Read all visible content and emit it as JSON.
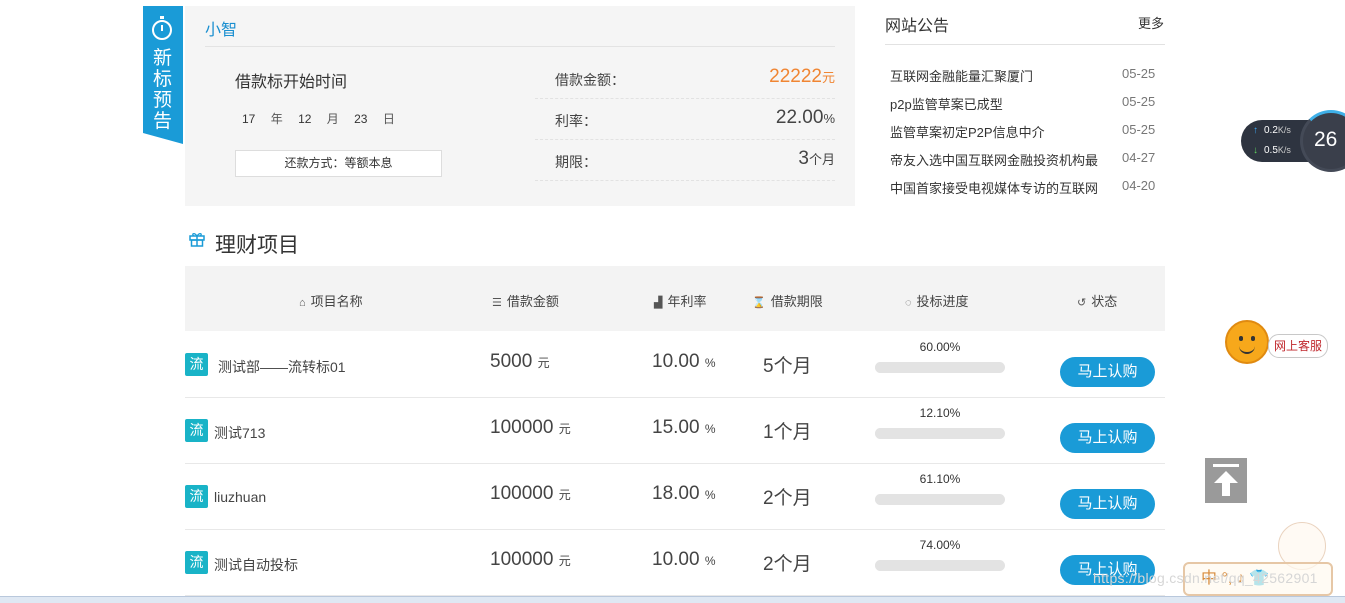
{
  "preview": {
    "ribbon_text": "新标预告",
    "name": "小智",
    "start_label": "借款标开始时间",
    "date": {
      "year": "17",
      "year_unit": "年",
      "month": "12",
      "month_unit": "月",
      "day": "23",
      "day_unit": "日"
    },
    "repay": "还款方式：等额本息",
    "amount_label": "借款金额：",
    "amount_value": "22222",
    "amount_unit": "元",
    "rate_label": "利率：",
    "rate_value": "22.00",
    "rate_unit": "%",
    "term_label": "期限：",
    "term_value": "3",
    "term_unit": "个月"
  },
  "notices": {
    "title": "网站公告",
    "more": "更多",
    "items": [
      {
        "title": "互联网金融能量汇聚厦门",
        "date": "05-25"
      },
      {
        "title": "p2p监管草案已成型",
        "date": "05-25"
      },
      {
        "title": "监管草案初定P2P信息中介",
        "date": "05-25"
      },
      {
        "title": "帝友入选中国互联网金融投资机构最",
        "date": "04-27"
      },
      {
        "title": "中国首家接受电视媒体专访的互联网",
        "date": "04-20"
      }
    ]
  },
  "section": {
    "title": "理财项目"
  },
  "table": {
    "headers": {
      "name": "项目名称",
      "amount": "借款金额",
      "rate": "年利率",
      "term": "借款期限",
      "progress": "投标进度",
      "status": "状态"
    },
    "header_icons": {
      "name": "home-icon",
      "amount": "database-icon",
      "rate": "bar-chart-icon",
      "term": "hourglass-icon",
      "progress": "spinner-icon",
      "status": "history-icon"
    },
    "rows": [
      {
        "badge": "流",
        "name": "测试部——流转标01",
        "amount": "5000",
        "amount_unit": "元",
        "rate": "10.00",
        "rate_unit": "%",
        "term": "5个月",
        "progress_text": "60.00%",
        "progress": 0.6,
        "button": "马上认购"
      },
      {
        "badge": "流",
        "name": "测试713",
        "amount": "100000",
        "amount_unit": "元",
        "rate": "15.00",
        "rate_unit": "%",
        "term": "1个月",
        "progress_text": "12.10%",
        "progress": 0.121,
        "button": "马上认购"
      },
      {
        "badge": "流",
        "name": "liuzhuan",
        "amount": "100000",
        "amount_unit": "元",
        "rate": "18.00",
        "rate_unit": "%",
        "term": "2个月",
        "progress_text": "61.10%",
        "progress": 0.611,
        "button": "马上认购"
      },
      {
        "badge": "流",
        "name": "测试自动投标",
        "amount": "100000",
        "amount_unit": "元",
        "rate": "10.00",
        "rate_unit": "%",
        "term": "2个月",
        "progress_text": "74.00%",
        "progress": 0.74,
        "button": "马上认购"
      }
    ]
  },
  "widgets": {
    "upload_speed": "0.2",
    "download_speed": "0.5",
    "speed_unit": "K/s",
    "gauge_value": "26",
    "service_label": "网上客服",
    "watermark": "https://blog.csdn.net/qq_42562901",
    "ime_text": "中 °, ♪ 👕"
  },
  "colors": {
    "accent": "#1a9bd7",
    "orange": "#f08532",
    "badge": "#19b3c7"
  }
}
